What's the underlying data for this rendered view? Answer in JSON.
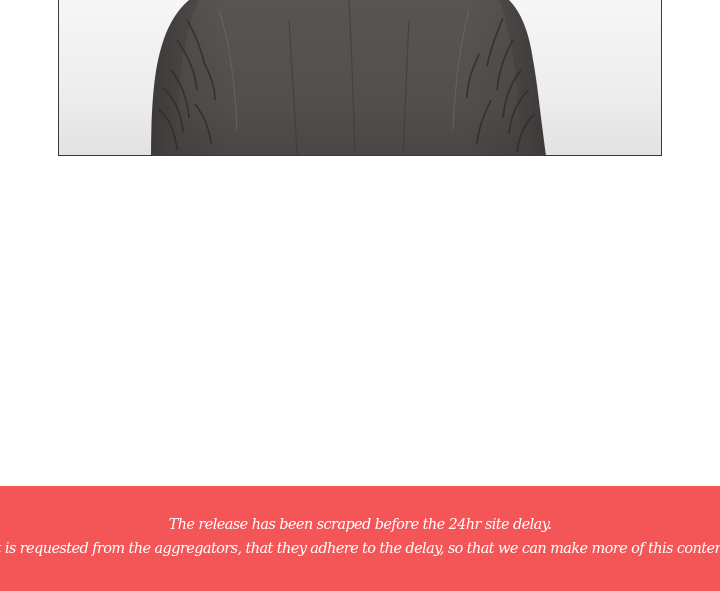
{
  "banner": {
    "line1": "The release has been scraped before the 24hr site delay.",
    "line2": "it is requested from the aggregators, that they adhere to the delay, so that we can make more of this content"
  },
  "colors": {
    "banner_background": "#f45658",
    "banner_text": "#ffffff",
    "page_background": "#ffffff"
  }
}
